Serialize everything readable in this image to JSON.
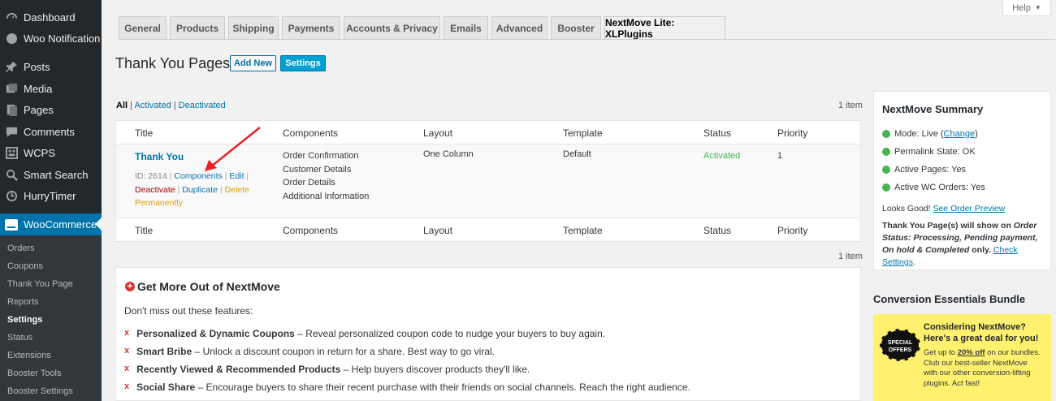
{
  "sidebar": {
    "items": [
      {
        "label": "Dashboard",
        "icon": "dashboard-icon"
      },
      {
        "label": "Woo Notification",
        "icon": "bell-icon"
      },
      {
        "label": "Posts",
        "icon": "pin-icon"
      },
      {
        "label": "Media",
        "icon": "media-icon"
      },
      {
        "label": "Pages",
        "icon": "page-icon"
      },
      {
        "label": "Comments",
        "icon": "comment-icon"
      },
      {
        "label": "WCPS",
        "icon": "grid-icon"
      },
      {
        "label": "Smart Search",
        "icon": "search-icon"
      },
      {
        "label": "HurryTimer",
        "icon": "timer-icon"
      }
    ],
    "active": {
      "label": "WooCommerce",
      "icon": "woo-icon"
    },
    "submenu": [
      "Orders",
      "Coupons",
      "Thank You Page",
      "Reports",
      "Settings",
      "Status",
      "Extensions",
      "Booster Tools",
      "Booster Settings"
    ],
    "submenu_current": "Settings"
  },
  "help": {
    "label": "Help"
  },
  "tabs": [
    "General",
    "Products",
    "Shipping",
    "Payments",
    "Accounts & Privacy",
    "Emails",
    "Advanced",
    "Booster",
    "NextMove Lite: XLPlugins"
  ],
  "active_tab": "NextMove Lite: XLPlugins",
  "page": {
    "title": "Thank You Pages",
    "add_new": "Add New",
    "settings": "Settings"
  },
  "filters": {
    "all": "All",
    "activated": "Activated",
    "deactivated": "Deactivated",
    "sep": "|"
  },
  "item_count": "1 item",
  "table": {
    "columns": [
      "Title",
      "Components",
      "Layout",
      "Template",
      "Status",
      "Priority"
    ],
    "row": {
      "title": "Thank You",
      "id": "ID: 2614",
      "actions": {
        "components": "Components",
        "edit": "Edit",
        "deactivate": "Deactivate",
        "duplicate": "Duplicate",
        "delete": "Delete Permanently"
      },
      "components": [
        "Order Confirmation",
        "Customer Details",
        "Order Details",
        "Additional Information"
      ],
      "layout": "One Column",
      "template": "Default",
      "status": "Activated",
      "priority": "1"
    }
  },
  "promo": {
    "title": "Get More Out of NextMove",
    "subtitle": "Don't miss out these features:",
    "features": [
      {
        "name": "Personalized & Dynamic Coupons",
        "desc": " – Reveal personalized coupon code to nudge your buyers to buy again."
      },
      {
        "name": "Smart Bribe",
        "desc": " – Unlock a discount coupon in return for a share. Best way to go viral."
      },
      {
        "name": "Recently Viewed & Recommended Products",
        "desc": " – Help buyers discover products they'll like."
      },
      {
        "name": "Social Share",
        "desc": " – Encourage buyers to share their recent purchase with their friends on social channels. Reach the right audience."
      }
    ],
    "bullet": "x"
  },
  "summary": {
    "title": "NextMove Summary",
    "mode_label": "Mode: Live (",
    "mode_link": "Change",
    "mode_end": ")",
    "permalink": "Permalink State: OK",
    "active_pages": "Active Pages: Yes",
    "active_wc": "Active WC Orders: Yes",
    "looks_good": "Looks Good! ",
    "preview_link": "See Order Preview",
    "note_start": "Thank You Page(s) will show on ",
    "note_status": "Order Status: Processing, Pending payment, On hold & Completed",
    "note_only": " only. ",
    "check_link": "Check Settings",
    "note_end": "."
  },
  "bundle": {
    "title": "Conversion Essentials Bundle",
    "badge": "SPECIAL OFFERS",
    "headline": "Considering NextMove? Here's a great deal for you!",
    "body_start": "Get up to ",
    "discount": "20% off",
    "body_end": " on our bundles. Club our best-seller NextMove with our other conversion-lifting plugins. Act fast!"
  },
  "colors": {
    "accent": "#0073aa",
    "sidebar": "#23282d",
    "active": "#46b450",
    "danger": "#a00",
    "promo": "#fff16d"
  }
}
